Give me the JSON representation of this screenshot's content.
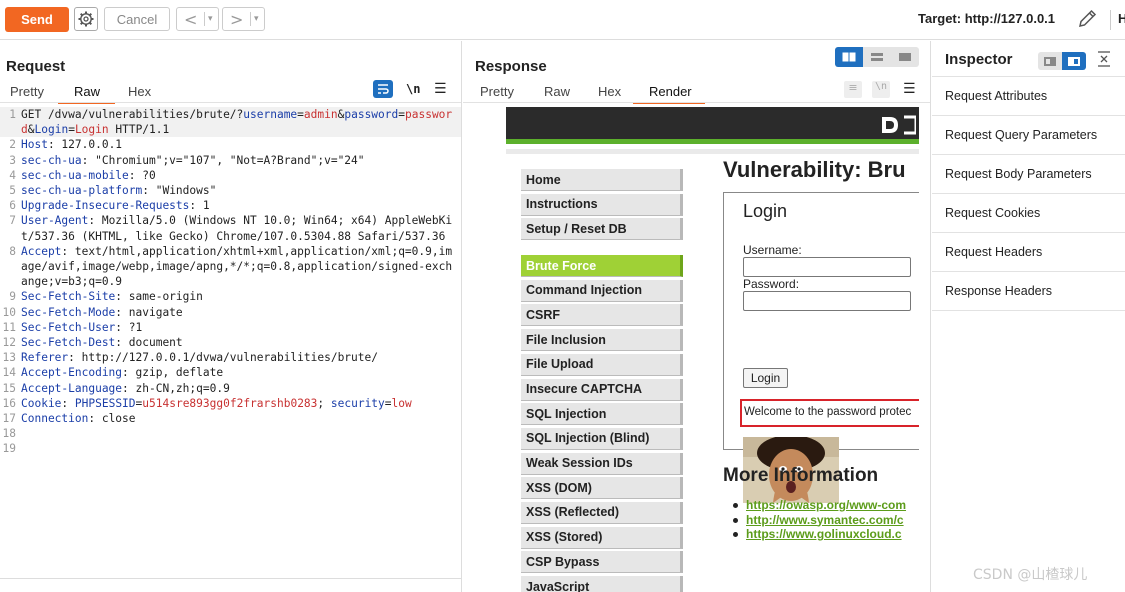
{
  "toolbar": {
    "send_label": "Send",
    "cancel_label": "Cancel",
    "target_label": "Target: http://127.0.0.1",
    "truncated_char": "H"
  },
  "request": {
    "title": "Request",
    "tabs": [
      "Pretty",
      "Raw",
      "Hex"
    ],
    "active_tab": "Raw",
    "newline_toggle": "\\n",
    "lines": [
      {
        "n": "1",
        "parts": [
          [
            "v",
            "GET /dvwa/vulnerabilities/brute/?"
          ],
          [
            "k",
            "username"
          ],
          [
            "v",
            "="
          ],
          [
            "red",
            "admin"
          ],
          [
            "v",
            "&"
          ],
          [
            "k",
            "password"
          ],
          [
            "v",
            "="
          ],
          [
            "red",
            "password"
          ],
          [
            "v",
            "&"
          ],
          [
            "k",
            "Login"
          ],
          [
            "v",
            "="
          ],
          [
            "red",
            "Login"
          ],
          [
            "v",
            " HTTP/1.1"
          ]
        ]
      },
      {
        "n": "2",
        "parts": [
          [
            "k",
            "Host"
          ],
          [
            "v",
            ": 127.0.0.1"
          ]
        ]
      },
      {
        "n": "3",
        "parts": [
          [
            "k",
            "sec-ch-ua"
          ],
          [
            "v",
            ": \"Chromium\";v=\"107\", \"Not=A?Brand\";v=\"24\""
          ]
        ]
      },
      {
        "n": "4",
        "parts": [
          [
            "k",
            "sec-ch-ua-mobile"
          ],
          [
            "v",
            ": ?0"
          ]
        ]
      },
      {
        "n": "5",
        "parts": [
          [
            "k",
            "sec-ch-ua-platform"
          ],
          [
            "v",
            ": \"Windows\""
          ]
        ]
      },
      {
        "n": "6",
        "parts": [
          [
            "k",
            "Upgrade-Insecure-Requests"
          ],
          [
            "v",
            ": 1"
          ]
        ]
      },
      {
        "n": "7",
        "parts": [
          [
            "k",
            "User-Agent"
          ],
          [
            "v",
            ": Mozilla/5.0 (Windows NT 10.0; Win64; x64) AppleWebKit/537.36 (KHTML, like Gecko) Chrome/107.0.5304.88 Safari/537.36"
          ]
        ]
      },
      {
        "n": "8",
        "parts": [
          [
            "k",
            "Accept"
          ],
          [
            "v",
            ": text/html,application/xhtml+xml,application/xml;q=0.9,image/avif,image/webp,image/apng,*/*;q=0.8,application/signed-exchange;v=b3;q=0.9"
          ]
        ]
      },
      {
        "n": "9",
        "parts": [
          [
            "k",
            "Sec-Fetch-Site"
          ],
          [
            "v",
            ": same-origin"
          ]
        ]
      },
      {
        "n": "10",
        "parts": [
          [
            "k",
            "Sec-Fetch-Mode"
          ],
          [
            "v",
            ": navigate"
          ]
        ]
      },
      {
        "n": "11",
        "parts": [
          [
            "k",
            "Sec-Fetch-User"
          ],
          [
            "v",
            ": ?1"
          ]
        ]
      },
      {
        "n": "12",
        "parts": [
          [
            "k",
            "Sec-Fetch-Dest"
          ],
          [
            "v",
            ": document"
          ]
        ]
      },
      {
        "n": "13",
        "parts": [
          [
            "k",
            "Referer"
          ],
          [
            "v",
            ": http://127.0.0.1/dvwa/vulnerabilities/brute/"
          ]
        ]
      },
      {
        "n": "14",
        "parts": [
          [
            "k",
            "Accept-Encoding"
          ],
          [
            "v",
            ": gzip, deflate"
          ]
        ]
      },
      {
        "n": "15",
        "parts": [
          [
            "k",
            "Accept-Language"
          ],
          [
            "v",
            ": zh-CN,zh;q=0.9"
          ]
        ]
      },
      {
        "n": "16",
        "parts": [
          [
            "k",
            "Cookie"
          ],
          [
            "v",
            ": "
          ],
          [
            "blu",
            "PHPSESSID"
          ],
          [
            "v",
            "="
          ],
          [
            "red",
            "u514sre893gg0f2frarshb0283"
          ],
          [
            "v",
            "; "
          ],
          [
            "blu",
            "security"
          ],
          [
            "v",
            "="
          ],
          [
            "red",
            "low"
          ]
        ]
      },
      {
        "n": "17",
        "parts": [
          [
            "k",
            "Connection"
          ],
          [
            "v",
            ": close"
          ]
        ]
      },
      {
        "n": "18",
        "parts": []
      },
      {
        "n": "19",
        "parts": []
      }
    ]
  },
  "response": {
    "title": "Response",
    "tabs": [
      "Pretty",
      "Raw",
      "Hex",
      "Render"
    ],
    "active_tab": "Render",
    "render": {
      "menu_group1": [
        "Home",
        "Instructions",
        "Setup / Reset DB"
      ],
      "menu_group2": [
        "Brute Force",
        "Command Injection",
        "CSRF",
        "File Inclusion",
        "File Upload",
        "Insecure CAPTCHA",
        "SQL Injection",
        "SQL Injection (Blind)",
        "Weak Session IDs",
        "XSS (DOM)",
        "XSS (Reflected)",
        "XSS (Stored)",
        "CSP Bypass",
        "JavaScript"
      ],
      "active_menu": "Brute Force",
      "heading": "Vulnerability: Bru",
      "login_title": "Login",
      "username_label": "Username:",
      "password_label": "Password:",
      "login_button": "Login",
      "welcome_text": "Welcome to the password protec",
      "more_info_heading": "More Information",
      "links": [
        "https://owasp.org/www-com",
        "http://www.symantec.com/c",
        "https://www.golinuxcloud.c"
      ]
    }
  },
  "inspector": {
    "title": "Inspector",
    "items": [
      "Request Attributes",
      "Request Query Parameters",
      "Request Body Parameters",
      "Request Cookies",
      "Request Headers",
      "Response Headers"
    ]
  },
  "watermark": "CSDN @山楂球儿",
  "colors": {
    "send": "#f26722",
    "toggle_active": "#1f6fbf",
    "dvwa_green": "#9fd136",
    "highlight_box": "#d8232a"
  }
}
